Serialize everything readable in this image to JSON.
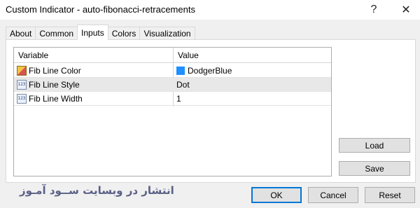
{
  "window": {
    "title": "Custom Indicator - auto-fibonacci-retracements",
    "help_glyph": "?",
    "close_glyph": "✕"
  },
  "tabs": [
    {
      "label": "About",
      "active": false
    },
    {
      "label": "Common",
      "active": false
    },
    {
      "label": "Inputs",
      "active": true
    },
    {
      "label": "Colors",
      "active": false
    },
    {
      "label": "Visualization",
      "active": false
    }
  ],
  "inputs_table": {
    "columns": [
      "Variable",
      "Value"
    ],
    "rows": [
      {
        "icon": "color-icon",
        "variable": "Fib Line Color",
        "value": "DodgerBlue",
        "swatch": "#1e90ff"
      },
      {
        "icon": "number-icon",
        "variable": "Fib Line Style",
        "value": "Dot"
      },
      {
        "icon": "number-icon",
        "variable": "Fib Line Width",
        "value": "1"
      }
    ],
    "number_icon_glyph": "123"
  },
  "side_buttons": {
    "load": "Load",
    "save": "Save"
  },
  "watermark": "انتشار در وبسایت ســود آمـوز",
  "footer": {
    "ok": "OK",
    "cancel": "Cancel",
    "reset": "Reset"
  }
}
